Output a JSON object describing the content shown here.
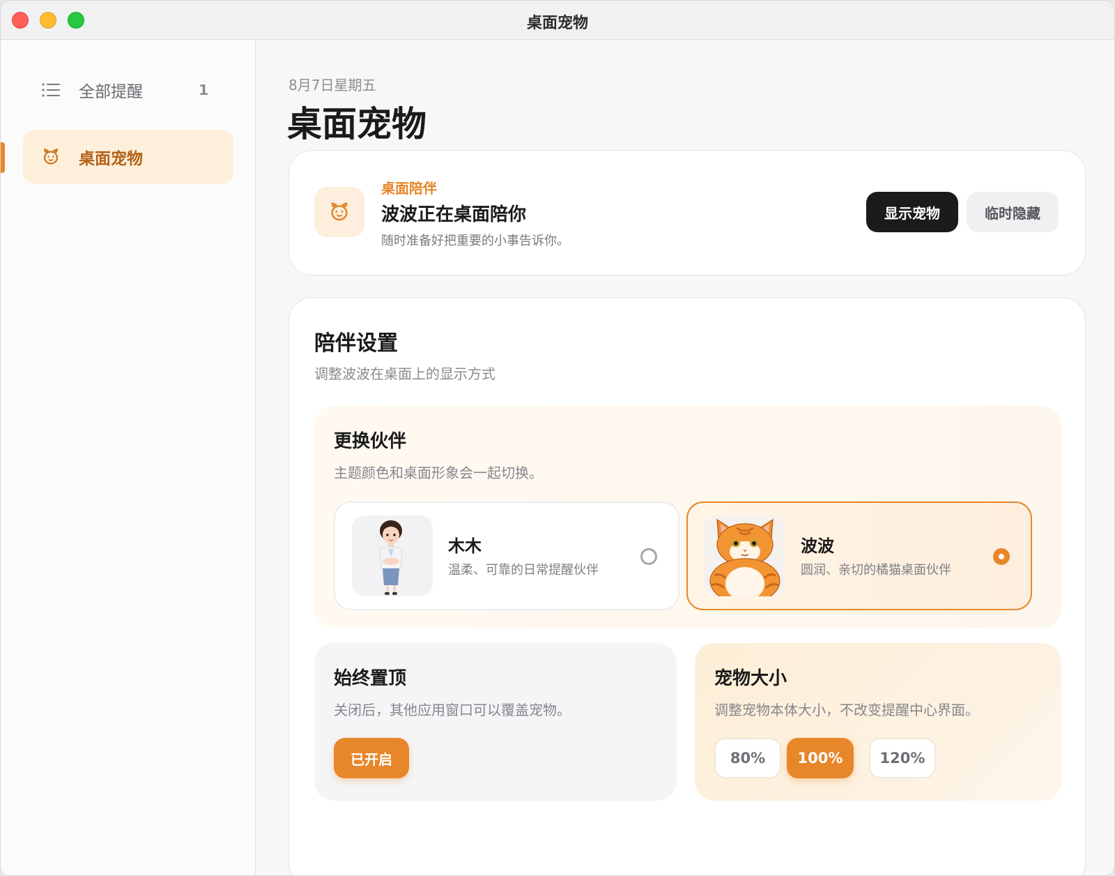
{
  "window": {
    "title": "桌面宠物"
  },
  "sidebar": {
    "items": [
      {
        "label": "全部提醒",
        "count": "1",
        "icon": "list-icon"
      },
      {
        "label": "桌面宠物",
        "icon": "pet-icon"
      }
    ]
  },
  "header": {
    "date": "8月7日星期五",
    "title": "桌面宠物"
  },
  "companion": {
    "kicker": "桌面陪伴",
    "title": "波波正在桌面陪你",
    "subtitle": "随时准备好把重要的小事告诉你。",
    "show_label": "显示宠物",
    "hide_label": "临时隐藏"
  },
  "settings": {
    "title": "陪伴设置",
    "subtitle": "调整波波在桌面上的显示方式",
    "switch": {
      "title": "更换伙伴",
      "subtitle": "主题颜色和桌面形象会一起切换。",
      "pets": [
        {
          "name": "木木",
          "desc": "温柔、可靠的日常提醒伙伴",
          "selected": false
        },
        {
          "name": "波波",
          "desc": "圆润、亲切的橘猫桌面伙伴",
          "selected": true
        }
      ]
    },
    "ontop": {
      "title": "始终置顶",
      "subtitle": "关闭后，其他应用窗口可以覆盖宠物。",
      "toggle_label": "已开启"
    },
    "size": {
      "title": "宠物大小",
      "subtitle": "调整宠物本体大小，不改变提醒中心界面。",
      "options": [
        "80%",
        "100%",
        "120%"
      ],
      "selected": "100%"
    }
  },
  "colors": {
    "accent": "#e8862a",
    "dark_button": "#1b1b1d"
  }
}
